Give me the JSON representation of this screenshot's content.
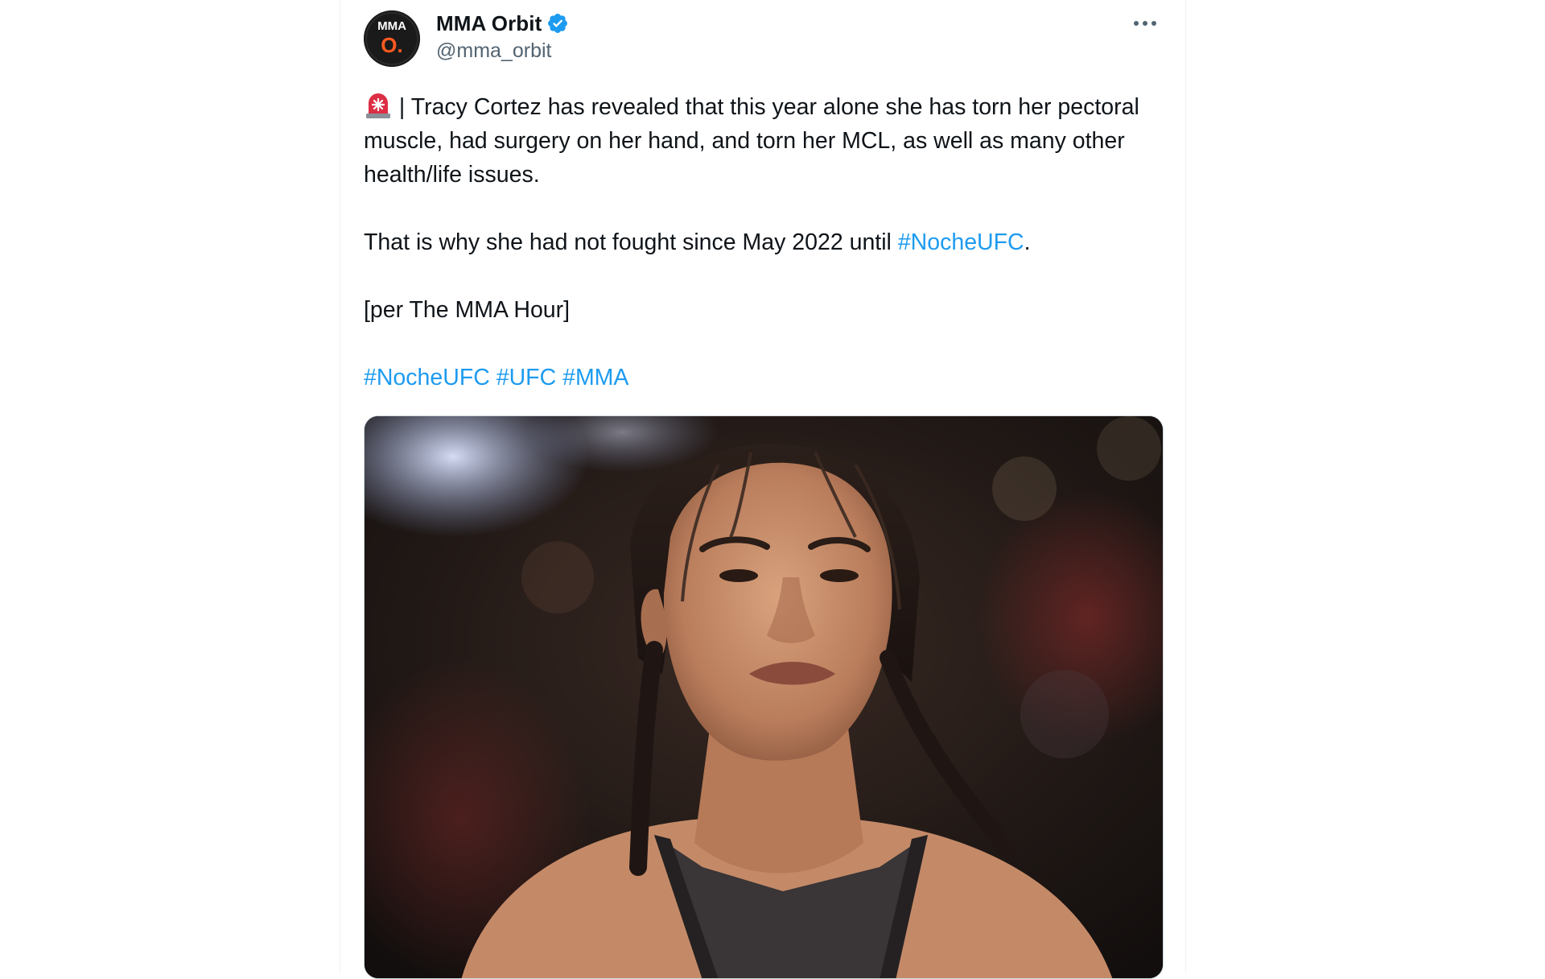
{
  "author": {
    "name": "MMA Orbit",
    "handle": "@mma_orbit",
    "avatar_text_top": "MMA",
    "avatar_text_bottom": "O."
  },
  "tweet": {
    "p1_text": "| Tracy Cortez has revealed that this year alone she has torn her pectoral muscle, had surgery on her hand, and torn her MCL, as well as many other health/life issues.",
    "p2_before": "That is why she had not fought since May 2022 until ",
    "p2_hashtag": "#NocheUFC",
    "p2_after": ".",
    "p3_text": "[per The MMA Hour]",
    "hashtags": [
      "#NocheUFC",
      "#UFC",
      "#MMA"
    ]
  },
  "icons": {
    "siren": "police-light-siren-icon",
    "verified": "verified-badge-icon",
    "more": "more-options-icon"
  },
  "colors": {
    "link": "#1d9bf0",
    "verified": "#1d9bf0",
    "text": "#0f1419",
    "secondary": "#536471",
    "avatar_accent": "#ff5a1f"
  }
}
